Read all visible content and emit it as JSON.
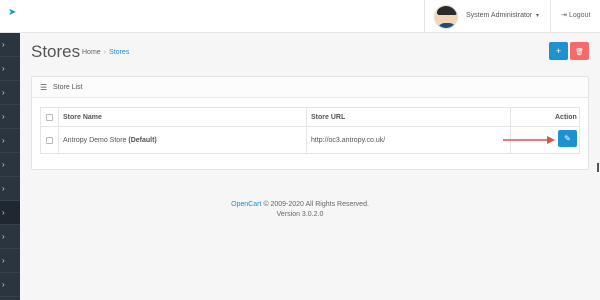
{
  "header": {
    "user_name": "System Administrator",
    "caret": "▾",
    "logout_label": "Logout"
  },
  "sidebar": {
    "item_count": 10,
    "chevron": "›"
  },
  "page": {
    "title": "Stores",
    "breadcrumb": {
      "home": "Home",
      "separator": "›",
      "current": "Stores"
    }
  },
  "buttons": {
    "add": "+",
    "delete": "🗑",
    "edit": "✎"
  },
  "panel": {
    "title": "Store List",
    "columns": {
      "name": "Store Name",
      "url": "Store URL",
      "action": "Action"
    },
    "rows": [
      {
        "name": "Antropy Demo Store",
        "name_suffix": "(Default)",
        "url": "http://oc3.antropy.co.uk/"
      }
    ]
  },
  "footer": {
    "brand": "OpenCart",
    "copyright": " © 2009-2020 All Rights Reserved.",
    "version": "Version 3.0.2.0"
  },
  "colors": {
    "accent": "#1e91cf",
    "danger": "#f56b6b",
    "sidebar": "#2b3540",
    "arrow": "#d9534f"
  }
}
